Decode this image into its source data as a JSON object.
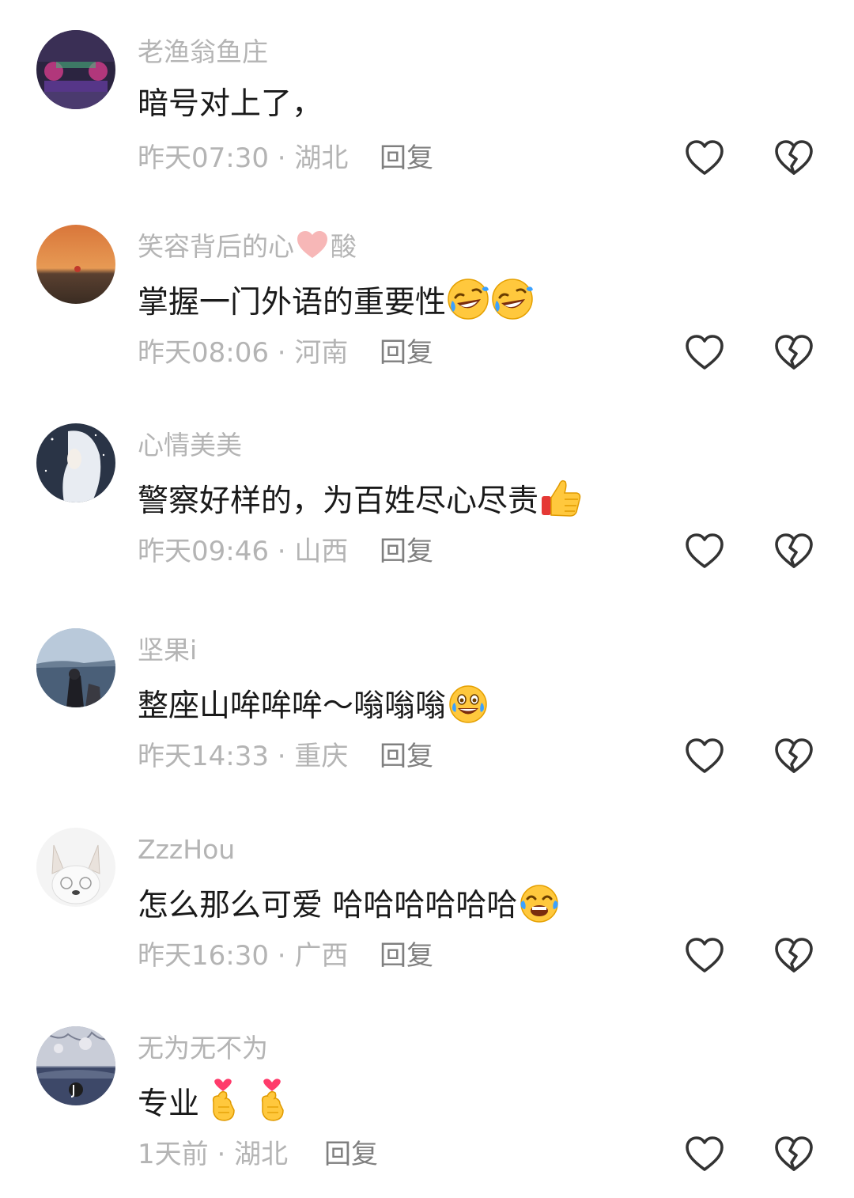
{
  "comments": [
    {
      "username": "老渔翁鱼庄",
      "text": "暗号对上了，",
      "time": "昨天07:30",
      "location": "湖北",
      "reply_label": "回复"
    },
    {
      "username_part1": "笑容背后的心",
      "username_part2": "酸",
      "text": "掌握一门外语的重要性",
      "time": "昨天08:06",
      "location": "河南",
      "reply_label": "回复"
    },
    {
      "username": "心情美美",
      "text": "警察好样的，为百姓尽心尽责",
      "time": "昨天09:46",
      "location": "山西",
      "reply_label": "回复"
    },
    {
      "username": "坚果i",
      "text": "整座山哞哞哞～嗡嗡嗡",
      "time": "昨天14:33",
      "location": "重庆",
      "reply_label": "回复"
    },
    {
      "username": "ZzzHou",
      "text": "怎么那么可爱 哈哈哈哈哈哈",
      "time": "昨天16:30",
      "location": "广西",
      "reply_label": "回复"
    },
    {
      "username": "无为无不为",
      "text": "专业",
      "time": "1天前",
      "location": "湖北",
      "reply_label": "回复"
    }
  ],
  "meta_separator": " · ",
  "icons": {
    "like": "heart-outline-icon",
    "dislike": "broken-heart-icon"
  },
  "colors": {
    "username": "#b4b4b4",
    "text": "#1a1a1a",
    "meta": "#b4b4b4",
    "reply": "#7f7f7f",
    "icon": "#333333"
  }
}
